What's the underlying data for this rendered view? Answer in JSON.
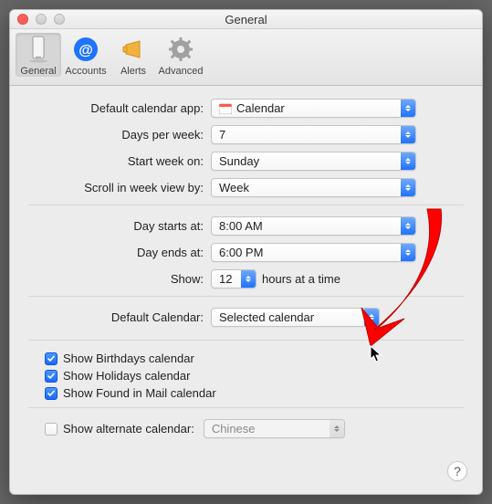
{
  "window": {
    "title": "General"
  },
  "toolbar": {
    "items": [
      {
        "label": "General"
      },
      {
        "label": "Accounts"
      },
      {
        "label": "Alerts"
      },
      {
        "label": "Advanced"
      }
    ]
  },
  "labels": {
    "default_app": "Default calendar app:",
    "days_per_week": "Days per week:",
    "start_week": "Start week on:",
    "scroll_week": "Scroll in week view by:",
    "day_starts": "Day starts at:",
    "day_ends": "Day ends at:",
    "show": "Show:",
    "hours_suffix": "hours at a time",
    "default_calendar": "Default Calendar:",
    "show_alternate": "Show alternate calendar:"
  },
  "values": {
    "default_app": "Calendar",
    "days_per_week": "7",
    "start_week": "Sunday",
    "scroll_week": "Week",
    "day_starts": "8:00 AM",
    "day_ends": "6:00 PM",
    "show_hours": "12",
    "default_calendar": "Selected calendar",
    "alternate_calendar": "Chinese"
  },
  "checkboxes": {
    "birthdays": "Show Birthdays calendar",
    "holidays": "Show Holidays calendar",
    "found_in_mail": "Show Found in Mail calendar"
  },
  "help": "?",
  "colors": {
    "accent": "#1f73ff",
    "arrow": "#ff0000"
  }
}
